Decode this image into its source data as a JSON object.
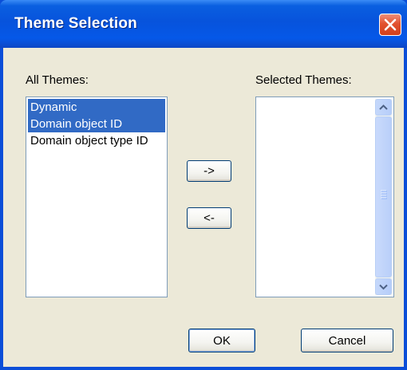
{
  "window": {
    "title": "Theme Selection",
    "close_icon": "close-icon"
  },
  "all_themes": {
    "label": "All Themes:",
    "items": [
      {
        "label": "Dynamic",
        "selected": true
      },
      {
        "label": "Domain object ID",
        "selected": true
      },
      {
        "label": "Domain object type ID",
        "selected": false
      }
    ]
  },
  "selected_themes": {
    "label": "Selected Themes:",
    "items": []
  },
  "buttons": {
    "add_label": "->",
    "remove_label": "<-",
    "ok_label": "OK",
    "cancel_label": "Cancel"
  },
  "colors": {
    "selection": "#316ac5",
    "titlebar": "#0753dc",
    "dialog_bg": "#ece9d8",
    "close_button": "#e2522f"
  }
}
